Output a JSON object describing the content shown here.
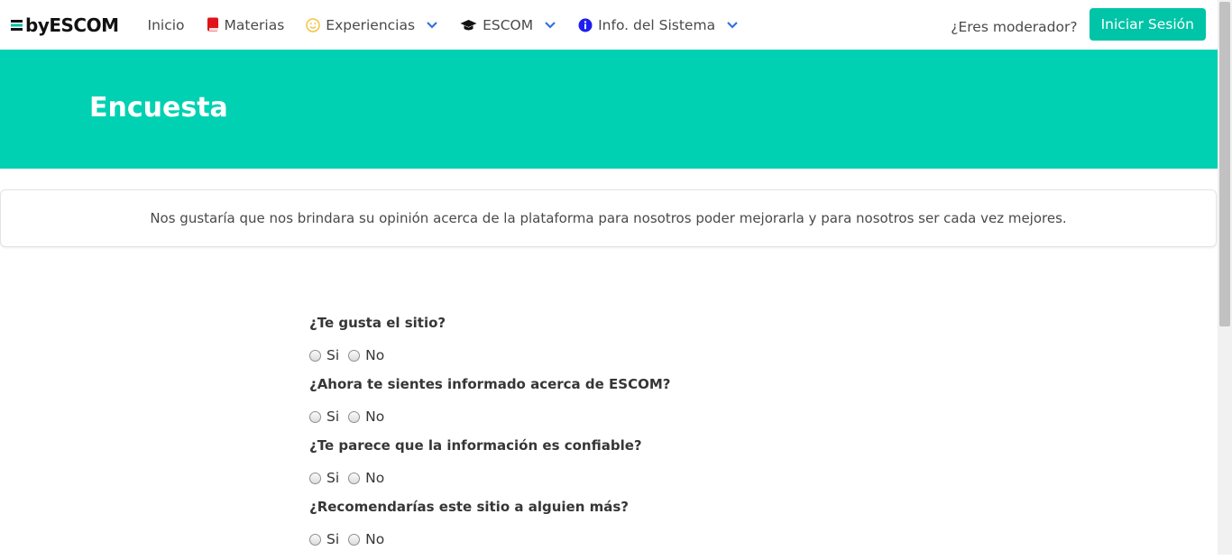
{
  "navbar": {
    "brand": "byESCOM",
    "items": [
      {
        "label": "Inicio",
        "icon": "none",
        "dropdown": false
      },
      {
        "label": "Materias",
        "icon": "book-icon",
        "dropdown": false
      },
      {
        "label": "Experiencias",
        "icon": "smiley-icon",
        "dropdown": true
      },
      {
        "label": "ESCOM",
        "icon": "graduation-cap-icon",
        "dropdown": true
      },
      {
        "label": "Info. del Sistema",
        "icon": "info-icon",
        "dropdown": true
      }
    ],
    "moderator_text": "¿Eres moderador?",
    "login_label": "Iniciar Sesión"
  },
  "hero": {
    "title": "Encuesta"
  },
  "notice": "Nos gustaría que nos brindara su opinión acerca de la plataforma para nosotros poder mejorarla y para nosotros ser cada vez mejores.",
  "survey": {
    "questions": [
      {
        "text": "¿Te gusta el sitio?",
        "options": [
          "Si",
          "No"
        ]
      },
      {
        "text": "¿Ahora te sientes informado acerca de ESCOM?",
        "options": [
          "Si",
          "No"
        ]
      },
      {
        "text": "¿Te parece que la información es confiable?",
        "options": [
          "Si",
          "No"
        ]
      },
      {
        "text": "¿Recomendarías este sitio a alguien más?",
        "options": [
          "Si",
          "No"
        ]
      }
    ]
  },
  "colors": {
    "primary": "#00d1b2",
    "button": "#00c4a7",
    "chevron": "#3273dc",
    "book": "#e0131b",
    "smiley": "#f5c242",
    "info": "#1e1ef0"
  }
}
